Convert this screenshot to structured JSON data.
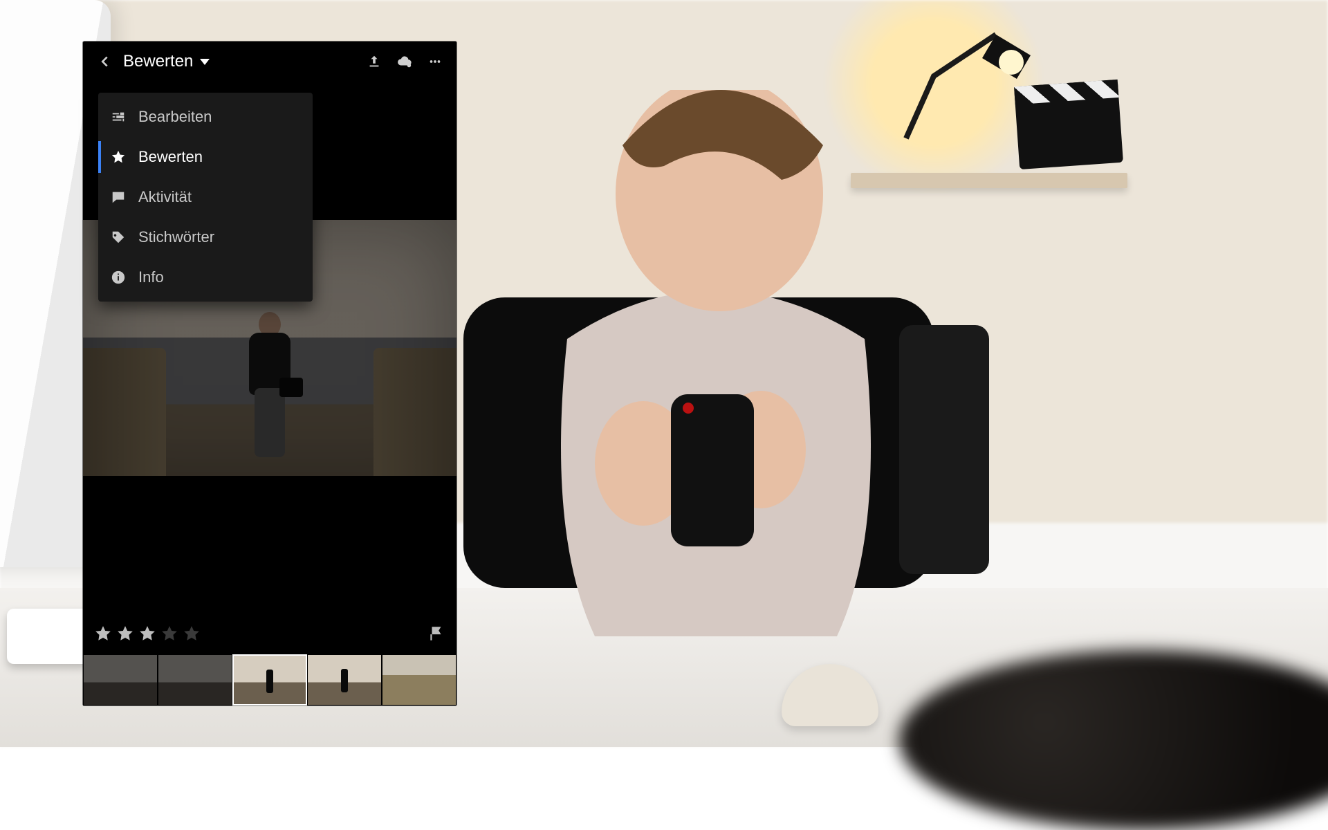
{
  "header": {
    "mode_label": "Bewerten"
  },
  "menu": {
    "items": [
      {
        "key": "edit",
        "label": "Bearbeiten",
        "selected": false
      },
      {
        "key": "rate",
        "label": "Bewerten",
        "selected": true
      },
      {
        "key": "activity",
        "label": "Aktivität",
        "selected": false
      },
      {
        "key": "keywords",
        "label": "Stichwörter",
        "selected": false
      },
      {
        "key": "info",
        "label": "Info",
        "selected": false
      }
    ]
  },
  "rating": {
    "stars": 3,
    "max": 5
  },
  "icons": {
    "back": "back-icon",
    "share": "share-icon",
    "cloud": "cloud-sync-icon",
    "more": "more-icon",
    "edit": "sliders-icon",
    "rate": "star-icon",
    "activity": "comment-icon",
    "keywords": "tag-icon",
    "info": "info-icon",
    "flag": "flag-icon"
  },
  "filmstrip": {
    "thumbs": [
      {
        "sel": false,
        "variant": "dark"
      },
      {
        "sel": false,
        "variant": "dark"
      },
      {
        "sel": true,
        "variant": "normal"
      },
      {
        "sel": false,
        "variant": "normal"
      },
      {
        "sel": false,
        "variant": "grass"
      }
    ]
  },
  "colors": {
    "accent": "#3b82f6"
  }
}
